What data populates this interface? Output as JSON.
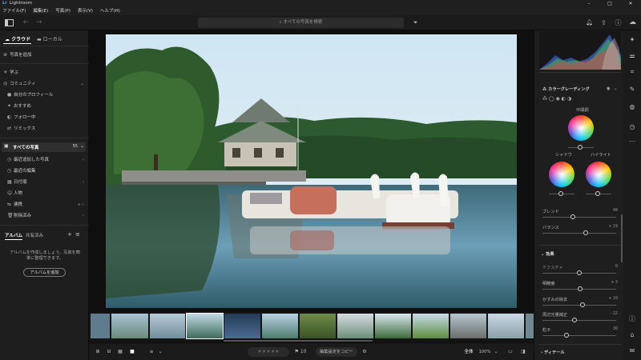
{
  "window": {
    "title": "Lightroom",
    "logo": "Lr"
  },
  "menu": [
    "ファイル(F)",
    "編集(E)",
    "写真(P)",
    "表示(V)",
    "ヘルプ(H)"
  ],
  "search": {
    "placeholder": "すべての写真を検索"
  },
  "left_panel": {
    "tabs": [
      "クラウド",
      "ローカル"
    ],
    "add_photos": "写真を追加",
    "learn": "学ぶ",
    "community": "コミュニティ",
    "community_items": [
      "自分のプロフィール",
      "おすすめ",
      "フォロー中",
      "リミックス"
    ],
    "all_photos": {
      "label": "すべての写真",
      "count": "55"
    },
    "library_items": [
      "最近追加した写真",
      "最近の編集",
      "日付順",
      "人物",
      "連携",
      "削除済み"
    ],
    "album_tabs": [
      "アルバム",
      "共有済み"
    ],
    "album_note": "アルバムを作成しましょう。写真を簡単に整理できます。",
    "create_album": "アルバムを追加"
  },
  "right_panel": {
    "section_color_grading": "カラーグレーディング",
    "midtones": "中間調",
    "shadows": "シャドウ",
    "highlights": "ハイライト",
    "blend": {
      "label": "ブレンド",
      "value": "48"
    },
    "balance": {
      "label": "バランス",
      "value": "+ 19"
    },
    "section_effects": "効果",
    "effects": [
      {
        "label": "テクスチャ",
        "value": "0"
      },
      {
        "label": "明瞭度",
        "value": "+ 3"
      },
      {
        "label": "かすみの除去",
        "value": "+ 10"
      },
      {
        "label": "周辺光量補正",
        "value": "- 22"
      },
      {
        "label": "粒子",
        "value": "30"
      }
    ],
    "section_detail": "ディテール"
  },
  "bottom_bar": {
    "copy_settings": "編集設定をコピー",
    "zoom_mode": "全体",
    "zoom_level": "100%",
    "flag_count": "10"
  },
  "colors": {
    "accent": "#4ea3ff",
    "panel": "#1e1e1e",
    "background": "#141414"
  }
}
